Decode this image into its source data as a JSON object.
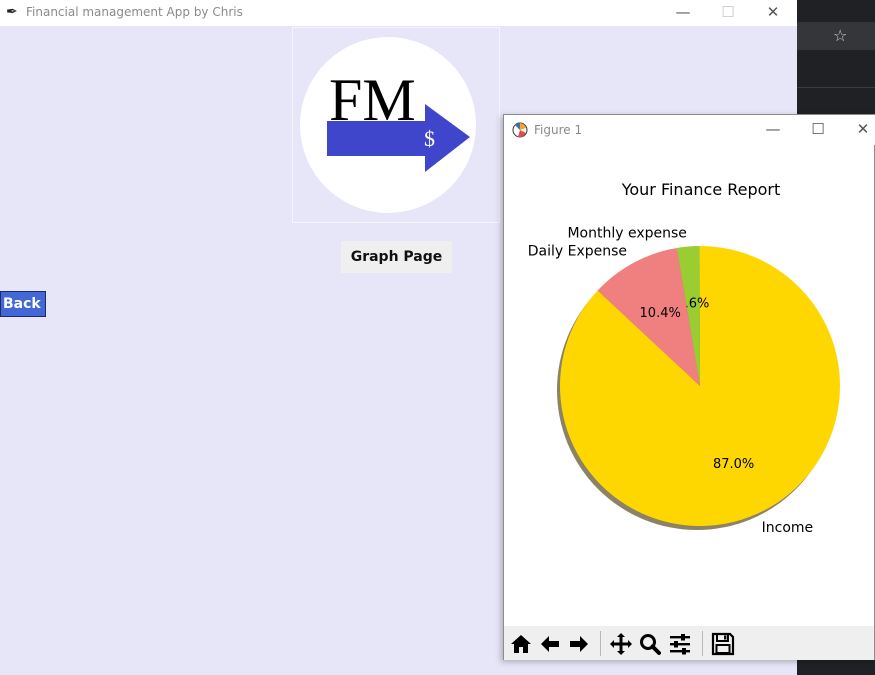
{
  "main_window": {
    "title": "Financial management App by Chris",
    "logo": {
      "text": "FM",
      "symbol": "$",
      "accent_color": "#4046cc"
    },
    "graph_page_label": "Graph Page",
    "back_label": "Back"
  },
  "figure_window": {
    "title": "Figure 1",
    "toolbar": [
      "home-icon",
      "back-arrow-icon",
      "forward-arrow-icon",
      "pan-icon",
      "zoom-icon",
      "configure-subplots-icon",
      "save-icon"
    ]
  },
  "chart_data": {
    "type": "pie",
    "title": "Your Finance Report",
    "slices": [
      {
        "label": "Income",
        "pct": 87.0,
        "pct_label": "87.0%",
        "color": "#ffd700"
      },
      {
        "label": "Monthly expense",
        "pct": 2.6,
        "pct_label": "2.6%",
        "color": "#9acd32"
      },
      {
        "label": "Daily Expense",
        "pct": 10.4,
        "pct_label": "10.4%",
        "color": "#f08080"
      }
    ],
    "shadow": true
  }
}
